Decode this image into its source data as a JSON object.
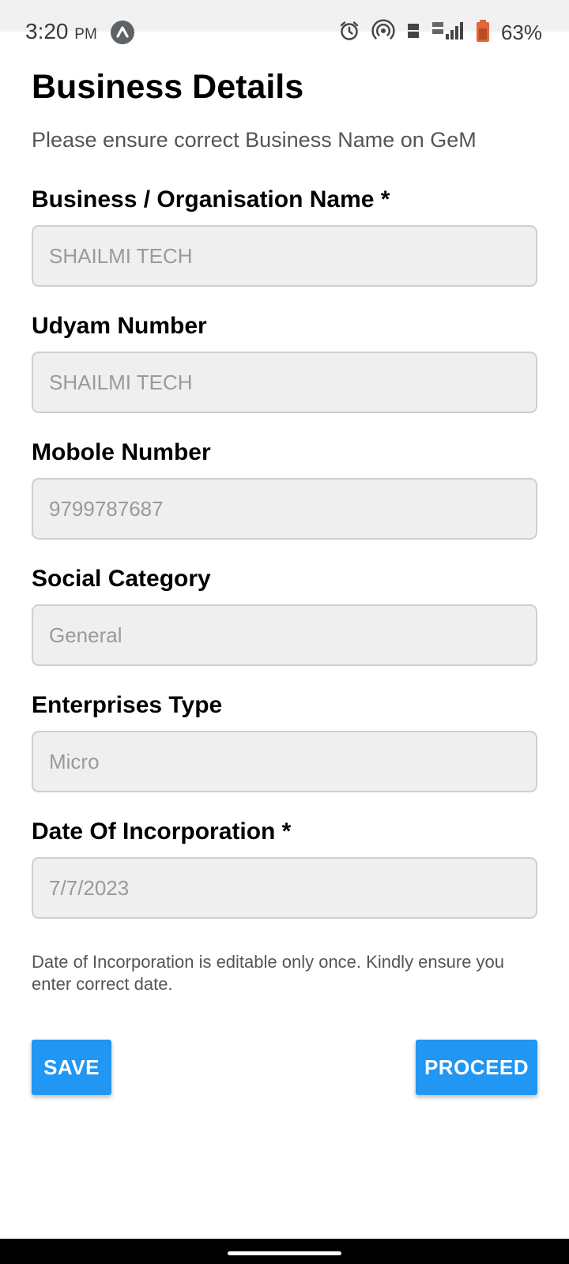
{
  "status_bar": {
    "time": "3:20",
    "ampm": "PM",
    "battery_percent": "63%",
    "icons": [
      "app-notification-icon",
      "alarm-icon",
      "hotspot-icon",
      "volte-icon",
      "lte-signal-icon",
      "battery-icon"
    ]
  },
  "page": {
    "title": "Business Details",
    "subtitle": "Please ensure correct Business Name on GeM"
  },
  "fields": [
    {
      "label": "Business / Organisation Name *",
      "value": "SHAILMI TECH"
    },
    {
      "label": "Udyam Number",
      "value": "SHAILMI TECH"
    },
    {
      "label": "Mobole Number",
      "value": "9799787687"
    },
    {
      "label": "Social Category",
      "value": "General"
    },
    {
      "label": "Enterprises Type",
      "value": "Micro"
    },
    {
      "label": "Date Of Incorporation *",
      "value": "7/7/2023"
    }
  ],
  "note": "Date of Incorporation is editable only once. Kindly ensure you enter correct date.",
  "buttons": {
    "save": "SAVE",
    "proceed": "PROCEED"
  },
  "colors": {
    "primary": "#2196f3",
    "field_background": "#efefef",
    "field_border": "#cfcfcf",
    "disabled_text": "#9a9a9a"
  }
}
